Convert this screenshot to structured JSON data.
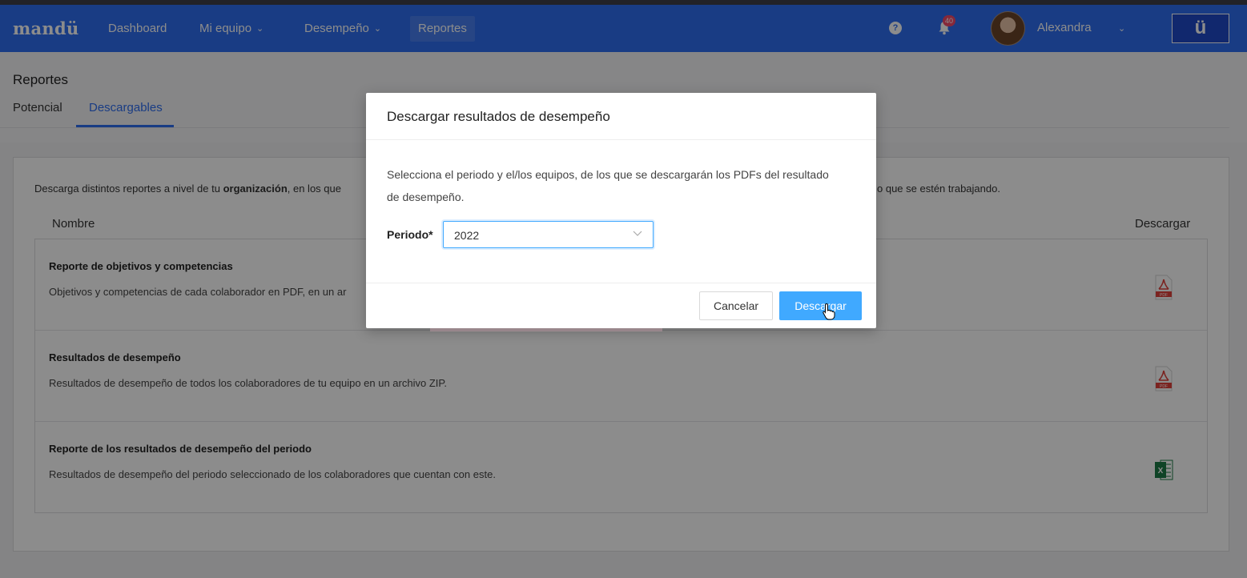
{
  "navbar": {
    "logo": "mandü",
    "items": [
      {
        "label": "Dashboard"
      },
      {
        "label": "Mi equipo",
        "chevron": "chevron-down-icon"
      },
      {
        "label": "Desempeño",
        "chevron": "chevron-down-icon"
      },
      {
        "label": "Reportes",
        "active": true
      }
    ],
    "help_glyph": "?",
    "notification_count": "40",
    "user_name": "Alexandra",
    "brand_glyph": "ü"
  },
  "page": {
    "title": "Reportes",
    "tabs": [
      {
        "label": "Potencial"
      },
      {
        "label": "Descargables",
        "active": true
      }
    ]
  },
  "card": {
    "intro_start": "Descarga distintos reportes a nivel de tu ",
    "intro_bold": "organización",
    "intro_mid": ", en los que",
    "intro_tail": "o que se estén trabajando.",
    "columns": {
      "name": "Nombre",
      "download": "Descargar"
    },
    "rows": [
      {
        "title": "Reporte de objetivos y competencias",
        "description": "Objetivos y competencias de cada colaborador en PDF, en un ar",
        "file_icon": "pdf-icon"
      },
      {
        "title": "Resultados de desempeño",
        "description": "Resultados de desempeño de todos los colaboradores de tu equipo en un archivo ZIP.",
        "file_icon": "pdf-icon"
      },
      {
        "title": "Reporte de los resultados de desempeño del periodo",
        "description": "Resultados de desempeño del periodo seleccionado de los colaboradores que cuentan con este.",
        "file_icon": "excel-icon"
      }
    ]
  },
  "modal": {
    "title": "Descargar resultados de desempeño",
    "text": "Selecciona el periodo y el/los equipos, de los que se descargarán los PDFs del resultado de desempeño.",
    "field_label": "Periodo*",
    "select_value": "2022",
    "cancel_label": "Cancelar",
    "confirm_label": "Descargar"
  },
  "colors": {
    "navbar": "#2f6ef0",
    "primary_button": "#40a9ff",
    "active_tab": "#2f6ef0",
    "pdf_red": "#e0413b",
    "excel_green": "#1d7a45"
  }
}
